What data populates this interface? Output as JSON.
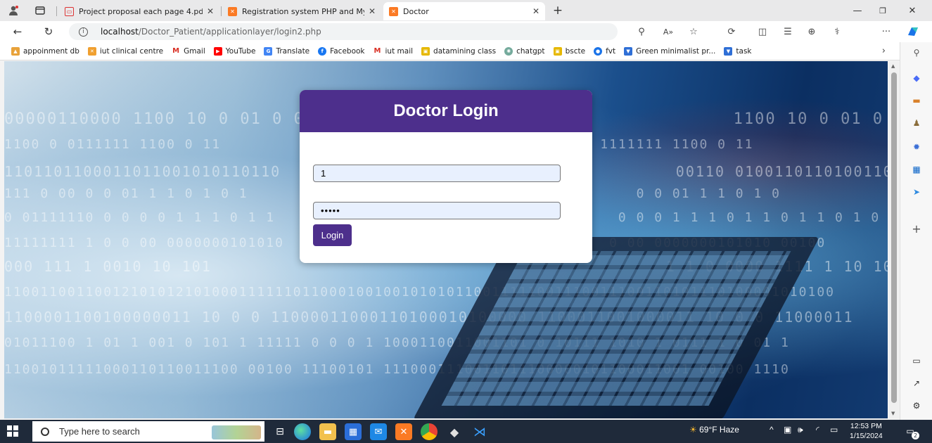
{
  "browser": {
    "tabs": [
      {
        "label": "Project proposal each page 4.pdf",
        "icon": "pdf-icon",
        "active": false
      },
      {
        "label": "Registration system PHP and My",
        "icon": "xampp-icon",
        "active": false
      },
      {
        "label": "Doctor",
        "icon": "xampp-icon",
        "active": true
      }
    ],
    "new_tab_label": "+",
    "url_host": "localhost",
    "url_path": "/Doctor_Patient/applicationlayer/login2.php",
    "bookmarks": [
      {
        "label": "appoinment db",
        "color": "#e8a23a"
      },
      {
        "label": "iut clinical centre",
        "color": "#f0a030"
      },
      {
        "label": "Gmail",
        "color": "#d93025"
      },
      {
        "label": "YouTube",
        "color": "#ff0000"
      },
      {
        "label": "Translate",
        "color": "#4285f4"
      },
      {
        "label": "Facebook",
        "color": "#1877f2"
      },
      {
        "label": "iut mail",
        "color": "#d93025"
      },
      {
        "label": "datamining class",
        "color": "#e6b800"
      },
      {
        "label": "chatgpt",
        "color": "#74aa9c"
      },
      {
        "label": "bscte",
        "color": "#e6b800"
      },
      {
        "label": "fvt",
        "color": "#1a73e8"
      },
      {
        "label": "Green minimalist pr...",
        "color": "#2f6fd6"
      },
      {
        "label": "task",
        "color": "#2f6fd6"
      }
    ]
  },
  "login": {
    "title": "Doctor Login",
    "username_value": "1",
    "password_value": "•••••",
    "button_label": "Login"
  },
  "taskbar": {
    "search_placeholder": "Type here to search",
    "weather": "69°F  Haze",
    "time": "12:53 PM",
    "date": "1/15/2024",
    "notification_count": "2"
  }
}
